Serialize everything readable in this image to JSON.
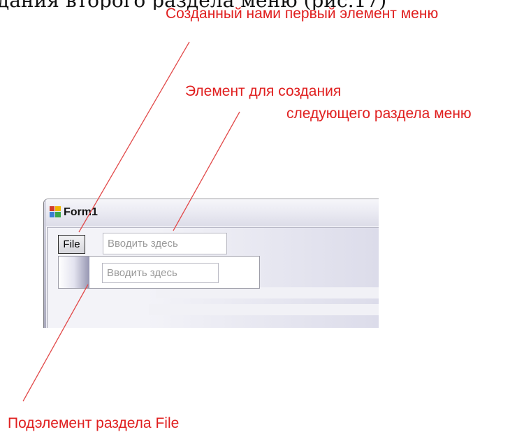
{
  "heading_fragment": "дания второго раздела меню (рис.17)",
  "annotations": {
    "first_item": "Созданный нами первый элемент меню",
    "next_section_line1": "Элемент для создания",
    "next_section_line2": "следующего раздела меню",
    "sub_item": "Подэлемент раздела File"
  },
  "window": {
    "title": "Form1"
  },
  "menu": {
    "file_label": "File",
    "type_here_placeholder": "Вводить здесь",
    "sub_type_here_placeholder": "Вводить здесь"
  },
  "colors": {
    "annotation": "#e02020",
    "leader": "#e24a4a"
  }
}
